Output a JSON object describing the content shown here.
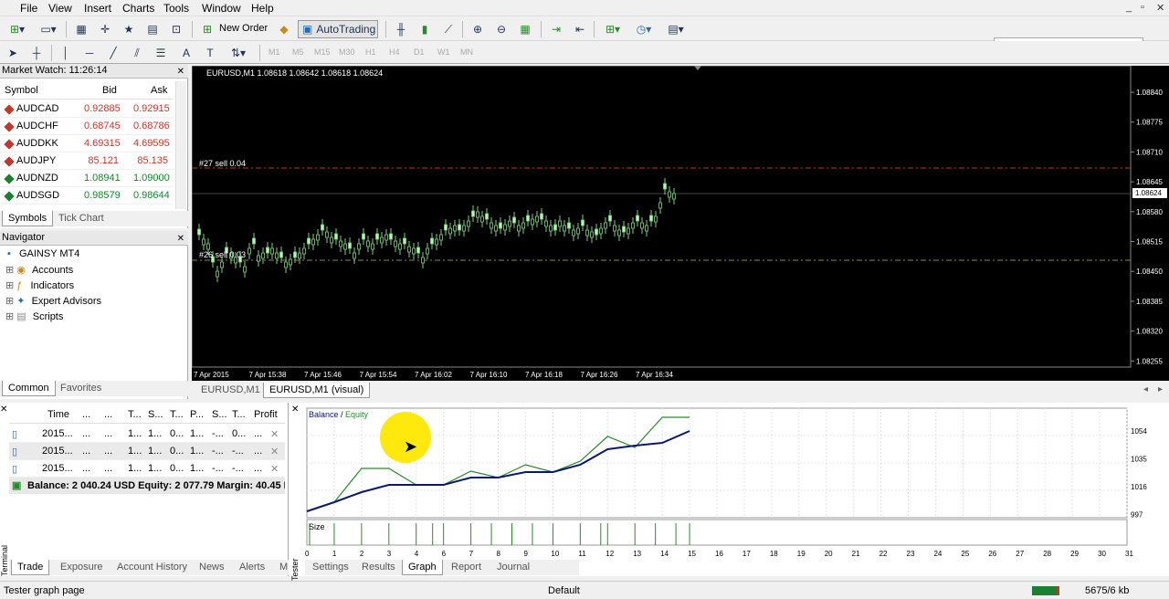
{
  "menu": [
    "File",
    "View",
    "Insert",
    "Charts",
    "Tools",
    "Window",
    "Help"
  ],
  "toolbar": {
    "new_order": "New Order",
    "autotrading": "AutoTrading"
  },
  "timeframes": [
    "M1",
    "M5",
    "M15",
    "M30",
    "H1",
    "H4",
    "D1",
    "W1",
    "MN"
  ],
  "market_watch": {
    "title": "Market Watch: 11:26:14",
    "cols": [
      "Symbol",
      "Bid",
      "Ask"
    ],
    "rows": [
      {
        "symbol": "AUDCAD",
        "bid": "0.92885",
        "ask": "0.92915",
        "color": "#c0392b"
      },
      {
        "symbol": "AUDCHF",
        "bid": "0.68745",
        "ask": "0.68786",
        "color": "#c0392b"
      },
      {
        "symbol": "AUDDKK",
        "bid": "4.69315",
        "ask": "4.69595",
        "color": "#c0392b"
      },
      {
        "symbol": "AUDJPY",
        "bid": "85.121",
        "ask": "85.135",
        "color": "#c0392b"
      },
      {
        "symbol": "AUDNZD",
        "bid": "1.08941",
        "ask": "1.09000",
        "color": "#1a7f2e"
      },
      {
        "symbol": "AUDSGD",
        "bid": "0.98579",
        "ask": "0.98644",
        "color": "#1a7f2e"
      }
    ],
    "tabs": [
      "Symbols",
      "Tick Chart"
    ]
  },
  "navigator": {
    "title": "Navigator",
    "root": "GAINSY MT4",
    "items": [
      "Accounts",
      "Indicators",
      "Expert Advisors",
      "Scripts"
    ],
    "tabs": [
      "Common",
      "Favorites"
    ]
  },
  "chart": {
    "header": "EURUSD,M1  1.08618 1.08642 1.08618 1.08624",
    "order1": "#27 sell 0.04",
    "order2": "#26 sell 0.03",
    "price_labels": [
      "1.08840",
      "1.08775",
      "1.08710",
      "1.08645",
      "1.08580",
      "1.08515",
      "1.08450",
      "1.08385",
      "1.08320",
      "1.08255"
    ],
    "current_price": "1.08624",
    "time_labels": [
      "7 Apr 2015",
      "7 Apr 15:38",
      "7 Apr 15:46",
      "7 Apr 15:54",
      "7 Apr 16:02",
      "7 Apr 16:10",
      "7 Apr 16:18",
      "7 Apr 16:26",
      "7 Apr 16:34"
    ],
    "tabs": [
      "EURUSD,M1",
      "EURUSD,M1 (visual)"
    ]
  },
  "terminal": {
    "vtab": "Terminal",
    "cols": [
      "Time",
      "...",
      "...",
      "T...",
      "S...",
      "T...",
      "P...",
      "S...",
      "T...",
      "S...",
      "Profit"
    ],
    "rows": [
      [
        "2015...",
        "...",
        "...",
        "1...",
        "1...",
        "0...",
        "1...",
        "-...",
        "0...",
        "..."
      ],
      [
        "2015...",
        "...",
        "...",
        "1...",
        "1...",
        "0...",
        "1...",
        "-...",
        "-...",
        "..."
      ],
      [
        "2015...",
        "...",
        "...",
        "1...",
        "1...",
        "0...",
        "1...",
        "-...",
        "-...",
        "..."
      ]
    ],
    "balance": "Balance: 2 040.24 USD  Equity: 2 077.79  Margin: 40.45  Fre",
    "tabs": [
      "Trade",
      "Exposure",
      "Account History",
      "News",
      "Alerts",
      "M"
    ]
  },
  "tester": {
    "vtab": "Tester",
    "legend_balance": "Balance",
    "legend_sep": " / ",
    "legend_equity": "Equity",
    "size_label": "Size",
    "y_labels": [
      "1054",
      "1035",
      "1016",
      "997"
    ],
    "x_labels": [
      "0",
      "1",
      "2",
      "3",
      "4",
      "6",
      "7",
      "8",
      "9",
      "10",
      "11",
      "12",
      "13",
      "14",
      "15",
      "16",
      "17",
      "18",
      "19",
      "20",
      "21",
      "22",
      "23",
      "24",
      "25",
      "26",
      "27",
      "28",
      "29",
      "30",
      "31"
    ],
    "tabs": [
      "Settings",
      "Results",
      "Graph",
      "Report",
      "Journal"
    ]
  },
  "status": {
    "left": "Tester graph page",
    "profile": "Default",
    "memory": "5675/6 kb"
  }
}
